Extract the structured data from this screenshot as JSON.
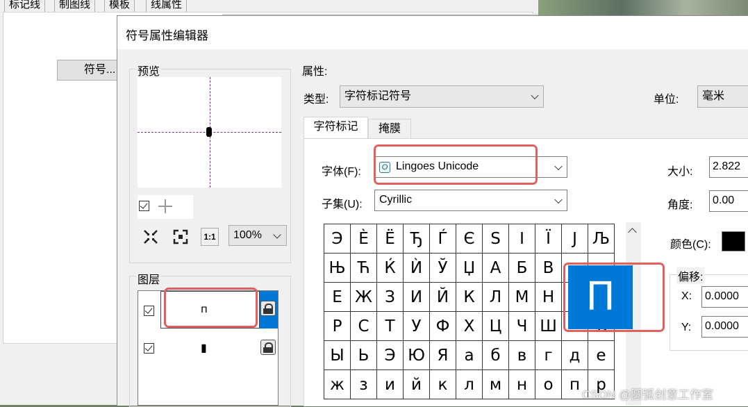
{
  "background_window": {
    "tabs": [
      "标记线",
      "制图线",
      "模板",
      "线属性"
    ],
    "symbol_button_label": "符号..."
  },
  "dialog": {
    "title": "符号属性编辑器",
    "preview": {
      "group_label": "预览",
      "zoom_value": "100%",
      "icon_names": [
        "fit-icon",
        "expand-icon",
        "actual-size-icon"
      ],
      "actual_size_label": "1:1"
    },
    "layers": {
      "group_label": "图层",
      "rows": [
        {
          "checked": true,
          "glyph": "п",
          "selected": true
        },
        {
          "checked": true,
          "glyph": "▮",
          "selected": false
        }
      ]
    },
    "properties": {
      "group_label": "属性:",
      "type_label": "类型:",
      "type_value": "字符标记符号",
      "unit_label": "单位:",
      "unit_value": "毫米",
      "tabs": [
        "字符标记",
        "掩膜"
      ],
      "font_label": "字体(F):",
      "font_value": "Lingoes Unicode",
      "subset_label": "子集(U):",
      "subset_value": "Cyrillic",
      "size_label": "大小:",
      "size_value": "2.822",
      "angle_label": "角度:",
      "angle_value": "0.00",
      "color_label": "颜色(C):",
      "color_value": "#000000",
      "offset_label": "偏移:",
      "x_label": "X:",
      "x_value": "0.0000",
      "y_label": "Y:",
      "y_value": "0.0000",
      "glyph_rows": [
        [
          "Э",
          "È",
          "Ë",
          "Ђ",
          "Ѓ",
          "Є",
          "S",
          "І",
          "Ї",
          "J",
          "Љ"
        ],
        [
          "Њ",
          "Ћ",
          "Ќ",
          "Ѝ",
          "Ў",
          "Џ",
          "А",
          "Б",
          "В",
          "",
          ""
        ],
        [
          "Е",
          "Ж",
          "З",
          "И",
          "Й",
          "К",
          "Л",
          "М",
          "Н",
          "",
          ""
        ],
        [
          "Р",
          "С",
          "Т",
          "У",
          "Ф",
          "Х",
          "Ц",
          "Ч",
          "Ш",
          "",
          "Ъ"
        ],
        [
          "Ы",
          "Ь",
          "Э",
          "Ю",
          "Я",
          "а",
          "б",
          "в",
          "г",
          "д",
          "е"
        ],
        [
          "ж",
          "з",
          "и",
          "й",
          "к",
          "л",
          "м",
          "н",
          "о",
          "п",
          "р"
        ]
      ],
      "zoomed_glyph": "П"
    }
  },
  "watermark": "CSDN @圆弧创意工作室",
  "colors": {
    "highlight": "#e0605e",
    "selection": "#0078d7",
    "guide_dash": "#7a2a8a"
  }
}
